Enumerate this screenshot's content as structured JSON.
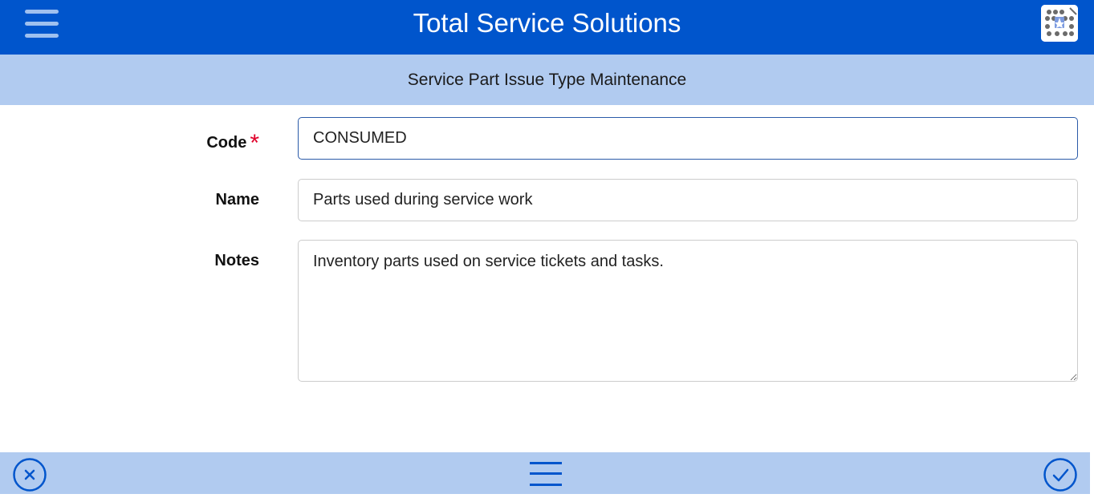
{
  "header": {
    "title": "Total Service Solutions",
    "menu_icon": "hamburger-menu-icon",
    "logo_icon": "app-logo-icon",
    "background": "#0055cc"
  },
  "subheader": {
    "title": "Service Part Issue Type Maintenance",
    "background": "#b1cbf0"
  },
  "form": {
    "code": {
      "label": "Code",
      "required_mark": "*",
      "value": "CONSUMED"
    },
    "name": {
      "label": "Name",
      "value": "Parts used during service work"
    },
    "notes": {
      "label": "Notes",
      "value": "Inventory parts used on service tickets and tasks."
    }
  },
  "footer": {
    "cancel_icon": "cancel-circle-icon",
    "menu_icon": "menu-icon",
    "confirm_icon": "confirm-check-icon",
    "accent": "#0055cc"
  }
}
